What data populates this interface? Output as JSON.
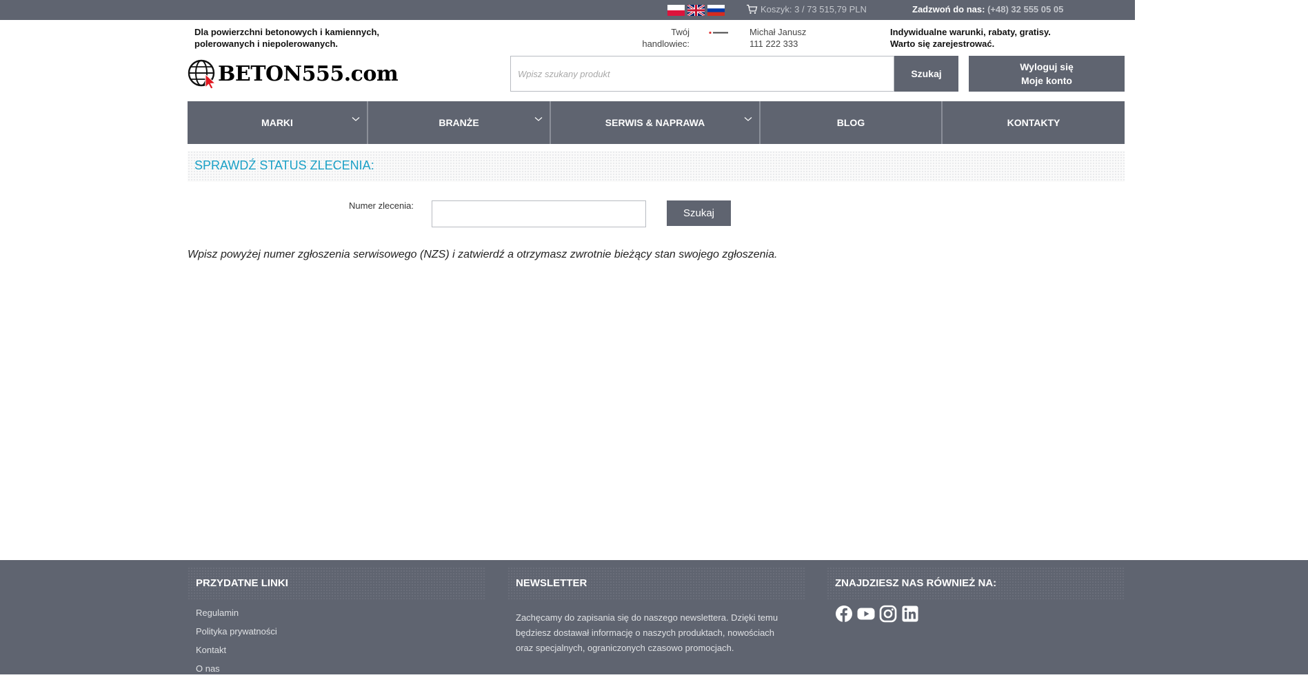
{
  "topbar": {
    "cart_text": "Koszyk: 3 / 73 515,79 PLN",
    "phone_label": "Zadzwoń do nas:",
    "phone_number": "(+48) 32 555 05 05",
    "flags": [
      "flag-pl-icon",
      "flag-uk-icon",
      "flag-ru-icon"
    ],
    "cart_icon": "cart-icon"
  },
  "header": {
    "tagline_line1": "Dla powierzchni betonowych i kamiennych,",
    "tagline_line2": "polerowanych i niepolerowanych.",
    "trader_label_line1": "Twój",
    "trader_label_line2": "handlowiec:",
    "trader_name": "Michał Janusz",
    "trader_phone": "111 222 333",
    "promo_line1": "Indywidualne warunki, rabaty, gratisy.",
    "promo_line2": "Warto się zarejestrować.",
    "logo_text": "BETON555.com"
  },
  "search": {
    "placeholder": "Wpisz szukany produkt",
    "button_label": "Szukaj"
  },
  "account": {
    "logout_label": "Wyloguj się",
    "my_account_label": "Moje konto"
  },
  "nav": {
    "items": [
      {
        "label": "MARKI"
      },
      {
        "label": "BRANŻE"
      },
      {
        "label": "SERWIS & NAPRAWA"
      },
      {
        "label": "BLOG"
      },
      {
        "label": "KONTAKTY"
      }
    ]
  },
  "main": {
    "section_title": "SPRAWDŹ STATUS ZLECENIA:",
    "order_label": "Numer zlecenia:",
    "order_value": "",
    "search_button": "Szukaj",
    "info_text": "Wpisz powyżej numer zgłoszenia serwisowego (NZS) i zatwierdź a otrzymasz zwrotnie bieżący stan swojego zgłoszenia."
  },
  "footer": {
    "links_title": "PRZYDATNE LINKI",
    "links": [
      "Regulamin",
      "Polityka prywatności",
      "Kontakt",
      "O nas"
    ],
    "newsletter_title": "NEWSLETTER",
    "newsletter_text": "Zachęcamy do zapisania się do naszego newslettera. Dzięki temu będziesz dostawał informację o naszych produktach, nowościach oraz specjalnych, ograniczonych czasowo promocjach.",
    "social_title": "ZNAJDZIESZ NAS RÓWNIEŻ NA:",
    "social_icons": [
      "facebook-icon",
      "youtube-icon",
      "instagram-icon",
      "linkedin-icon"
    ]
  },
  "colors": {
    "bar": "#5f6470",
    "accent": "#1aa0c6"
  }
}
